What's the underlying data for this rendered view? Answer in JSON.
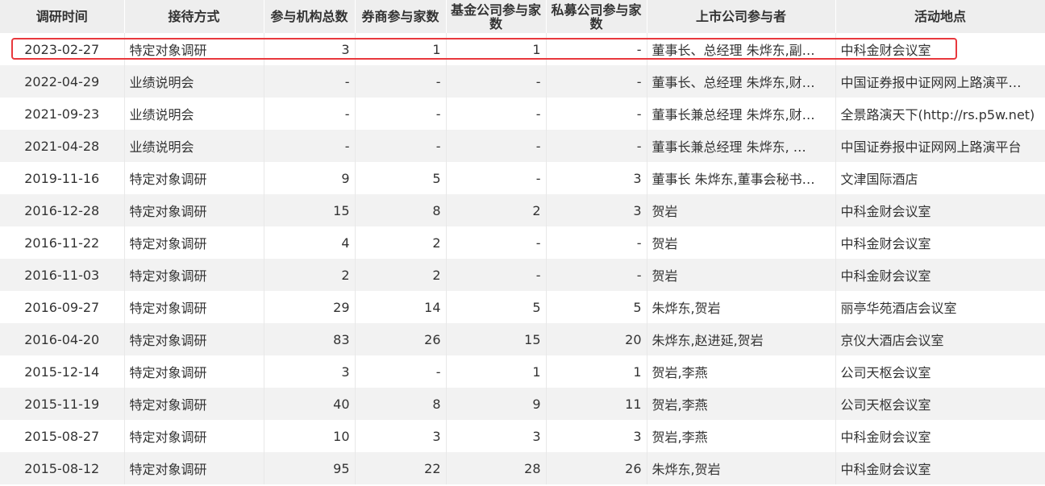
{
  "table": {
    "headers": [
      "调研时间",
      "接待方式",
      "参与机构总数",
      "券商参与家数",
      "基金公司参与家数",
      "私募公司参与家数",
      "上市公司参与者",
      "活动地点"
    ],
    "rows": [
      [
        "2023-02-27",
        "特定对象调研",
        "3",
        "1",
        "1",
        "-",
        "董事长、总经理 朱烨东,副…",
        "中科金财会议室"
      ],
      [
        "2022-04-29",
        "业绩说明会",
        "-",
        "-",
        "-",
        "-",
        "董事长、总经理 朱烨东,财…",
        "中国证券报中证网网上路演平…"
      ],
      [
        "2021-09-23",
        "业绩说明会",
        "-",
        "-",
        "-",
        "-",
        "董事长兼总经理 朱烨东,财…",
        "全景路演天下(http://rs.p5w.net)"
      ],
      [
        "2021-04-28",
        "业绩说明会",
        "-",
        "-",
        "-",
        "-",
        "董事长兼总经理 朱烨东, …",
        "中国证券报中证网网上路演平台"
      ],
      [
        "2019-11-16",
        "特定对象调研",
        "9",
        "5",
        "-",
        "3",
        "董事长 朱烨东,董事会秘书…",
        "文津国际酒店"
      ],
      [
        "2016-12-28",
        "特定对象调研",
        "15",
        "8",
        "2",
        "3",
        "贺岩",
        "中科金财会议室"
      ],
      [
        "2016-11-22",
        "特定对象调研",
        "4",
        "2",
        "-",
        "-",
        "贺岩",
        "中科金财会议室"
      ],
      [
        "2016-11-03",
        "特定对象调研",
        "2",
        "2",
        "-",
        "-",
        "贺岩",
        "中科金财会议室"
      ],
      [
        "2016-09-27",
        "特定对象调研",
        "29",
        "14",
        "5",
        "5",
        "朱烨东,贺岩",
        "丽亭华苑酒店会议室"
      ],
      [
        "2016-04-20",
        "特定对象调研",
        "83",
        "26",
        "15",
        "20",
        "朱烨东,赵进延,贺岩",
        "京仪大酒店会议室"
      ],
      [
        "2015-12-14",
        "特定对象调研",
        "3",
        "-",
        "1",
        "1",
        "贺岩,李燕",
        "公司天枢会议室"
      ],
      [
        "2015-11-19",
        "特定对象调研",
        "40",
        "8",
        "9",
        "11",
        "贺岩,李燕",
        "公司天枢会议室"
      ],
      [
        "2015-08-27",
        "特定对象调研",
        "10",
        "3",
        "3",
        "3",
        "贺岩,李燕",
        "中科金财会议室"
      ],
      [
        "2015-08-12",
        "特定对象调研",
        "95",
        "22",
        "28",
        "26",
        "朱烨东,贺岩",
        "中科金财会议室"
      ]
    ]
  },
  "colors": {
    "header_bg": "#eeeeee",
    "row_alt_bg": "#f2f2f2",
    "highlight_border": "#e8383d",
    "text": "#333333"
  }
}
